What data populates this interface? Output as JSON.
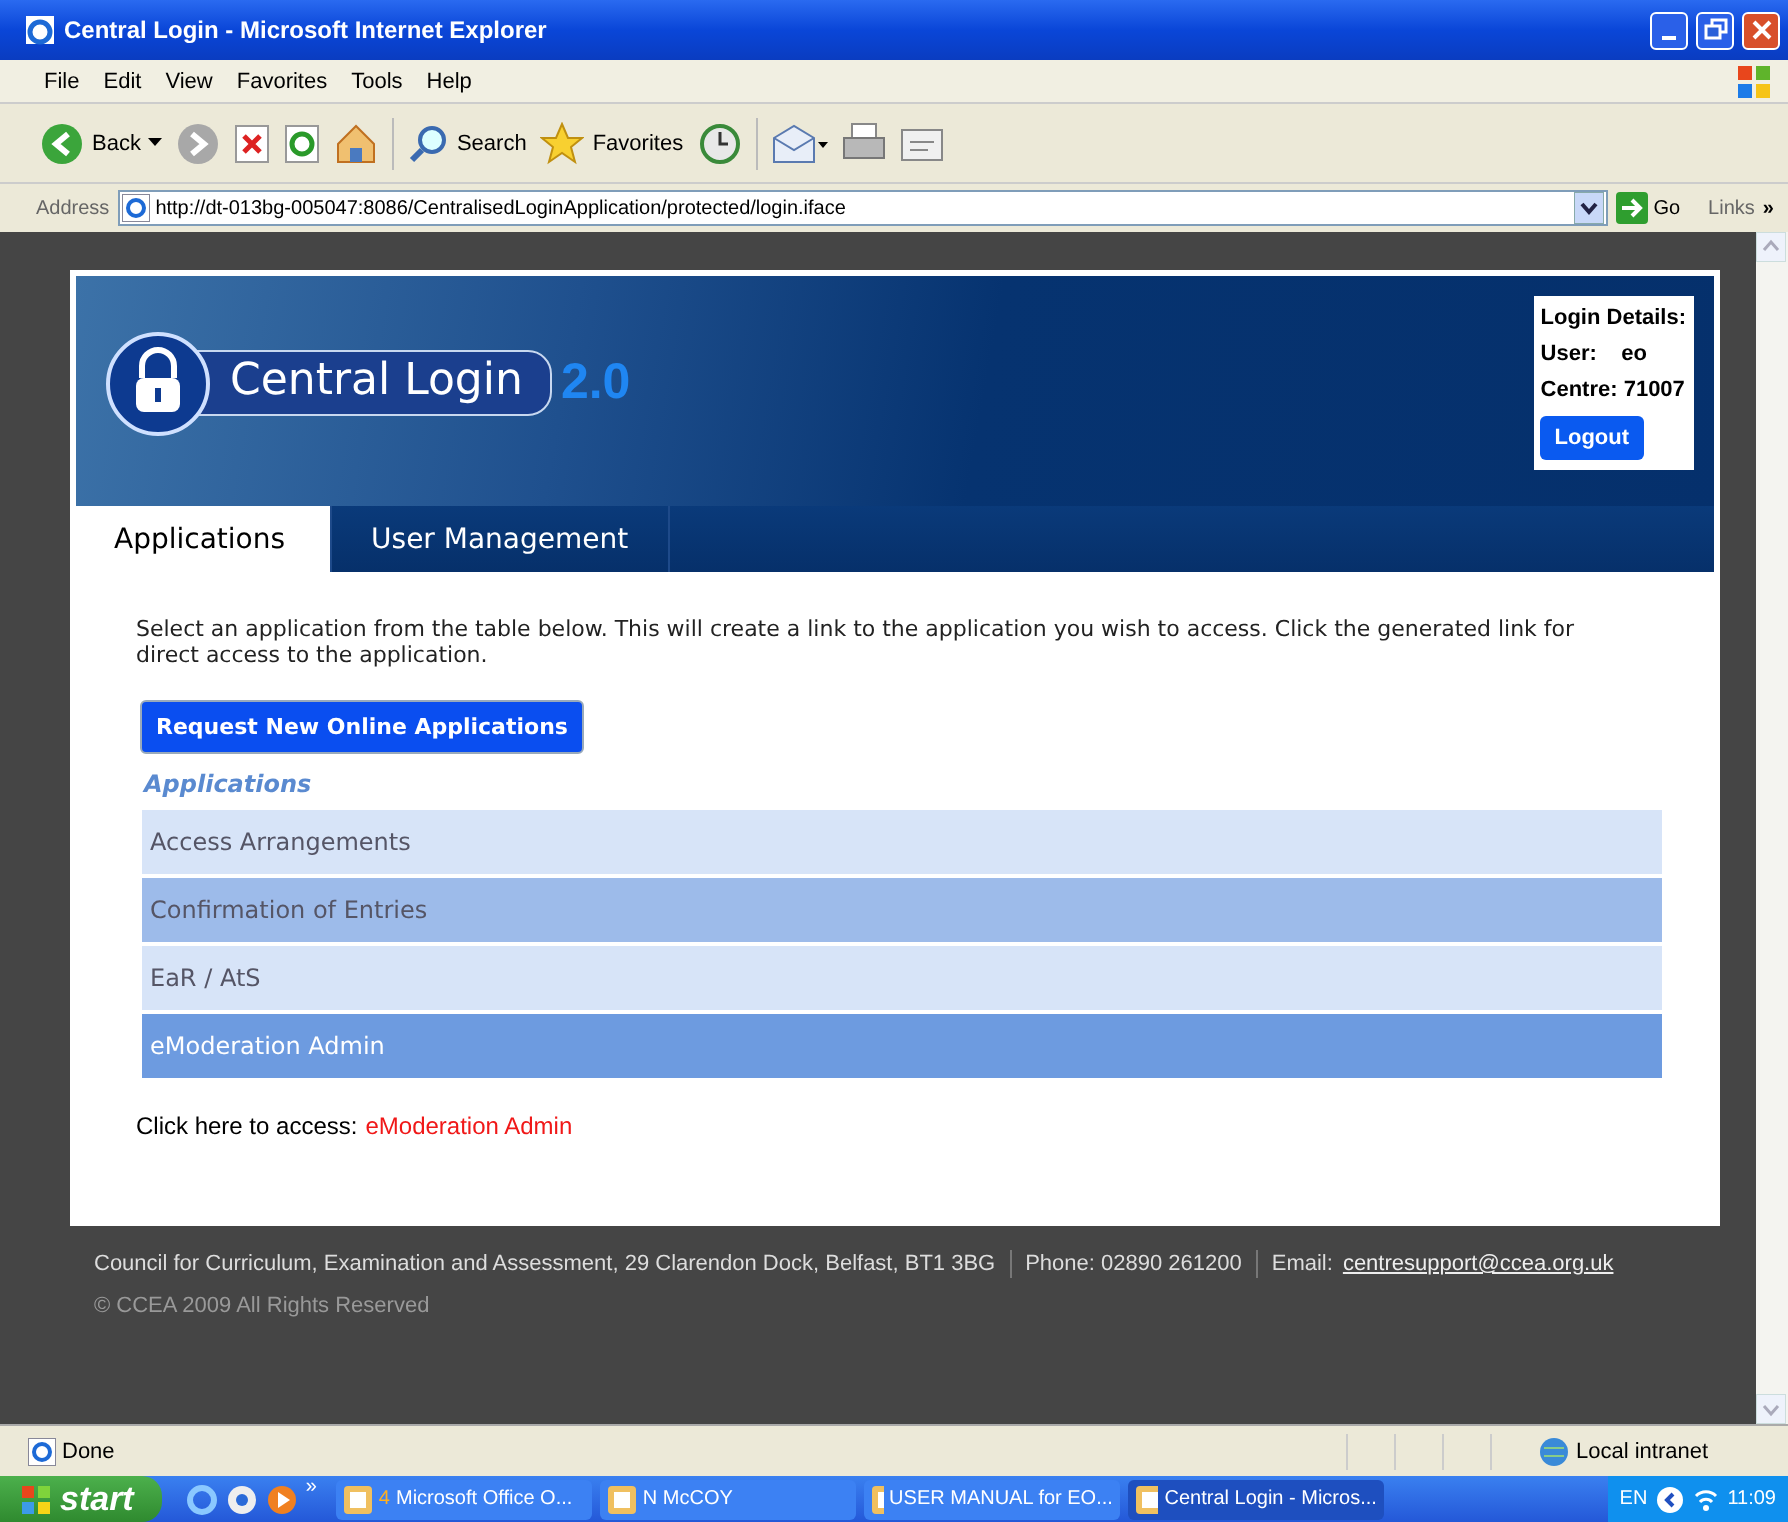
{
  "window": {
    "title": "Central Login - Microsoft Internet Explorer"
  },
  "menu": [
    "File",
    "Edit",
    "View",
    "Favorites",
    "Tools",
    "Help"
  ],
  "toolbar": {
    "back": "Back",
    "search": "Search",
    "favorites": "Favorites"
  },
  "address": {
    "label": "Address",
    "value": "http://dt-013bg-005047:8086/CentralisedLoginApplication/protected/login.iface",
    "go": "Go",
    "links": "Links",
    "more": "»"
  },
  "header": {
    "logo": "Central Login",
    "version": "2.0",
    "login_details": {
      "title": "Login Details:",
      "user_label": "User:",
      "user": "eo",
      "centre_label": "Centre:",
      "centre": "71007",
      "logout": "Logout"
    }
  },
  "tabs": [
    {
      "label": "Applications",
      "selected": true
    },
    {
      "label": "User Management",
      "selected": false
    }
  ],
  "intro": "Select an application from the table below. This will create a link to the application you wish to access. Click the generated link for direct access to the application.",
  "request_button": "Request New Online Applications",
  "applications": {
    "heading": "Applications",
    "rows": [
      {
        "name": "Access Arrangements",
        "selected": false
      },
      {
        "name": "Confirmation of Entries",
        "selected": false
      },
      {
        "name": "EaR / AtS",
        "selected": false
      },
      {
        "name": "eModeration Admin",
        "selected": true
      }
    ]
  },
  "access": {
    "label": "Click here to access:",
    "link": "eModeration Admin"
  },
  "footer": {
    "address": "Council for Curriculum, Examination and Assessment, 29 Clarendon Dock, Belfast, BT1 3BG",
    "phone": "Phone:  02890 261200",
    "email_label": "Email:",
    "email": "centresupport@ccea.org.uk",
    "copyright": "© CCEA 2009 All Rights Reserved"
  },
  "status_bar": {
    "text": "Done",
    "zone": "Local intranet"
  },
  "taskbar": {
    "start": "start",
    "more": "»",
    "tasks": [
      {
        "count": "4",
        "label": "Microsoft Office O...",
        "selected": false
      },
      {
        "label": "N McCOY",
        "selected": false
      },
      {
        "label": "USER MANUAL for EO...",
        "selected": false
      },
      {
        "label": "Central Login - Micros...",
        "selected": true
      }
    ],
    "lang": "EN",
    "clock": "11:09"
  }
}
